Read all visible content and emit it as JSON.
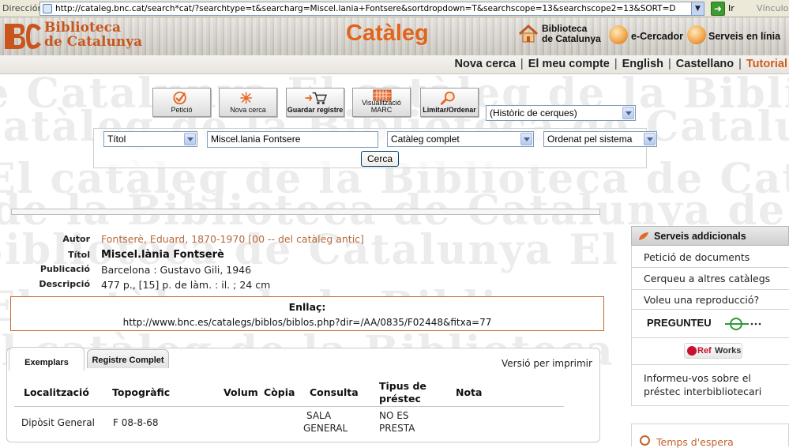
{
  "browser": {
    "address_label": "Dirección",
    "url": "http://cataleg.bnc.cat/search*cat/?searchtype=t&searcharg=Miscel.lania+Fontsere&sortdropdown=T&searchscope=13&searchscope2=13&SORT=D",
    "go_label": "Ir",
    "links_label": "Vínculos"
  },
  "watermark": {
    "line1": "de Catalunya El catàleg de la Biblioteca",
    "line2": "catàleg de la Biblioteca de Catalunya",
    "line3": "El catàleg de la Biblioteca de Catalunya",
    "line4": "de la Biblioteca de Catalunya de la Bibl",
    "line5": "Biblioteca de Catalunya El catàleg",
    "line6": "El catàleg de la Biblio",
    "line7": "El catàleg de la Biblioteca de Catalu"
  },
  "header": {
    "logo_line1": "Biblioteca",
    "logo_line2": "de Catalunya",
    "logo_mark": "BC",
    "app_title": "Catàleg",
    "links": [
      {
        "line1": "Biblioteca",
        "line2": "de Catalunya",
        "icon": "house-icon"
      },
      {
        "label": "e-Cercador",
        "icon": "magnifier-icon"
      },
      {
        "label": "Serveis en línia",
        "icon": "globe-icon"
      }
    ]
  },
  "topnav": {
    "items": [
      "Nova cerca",
      "El meu compte",
      "English",
      "Castellano",
      "Tutorial"
    ],
    "accent_color": "#d05a1b"
  },
  "toolbar": {
    "buttons": [
      {
        "label": "Petició",
        "icon": "checkmark-icon"
      },
      {
        "label": "Nova cerca",
        "icon": "sparkle-icon"
      },
      {
        "label": "Guardar registre",
        "icon": "cart-icon"
      },
      {
        "label1": "Visualització",
        "label2": "MARC",
        "icon": "grid-icon"
      },
      {
        "label": "Limitar/Ordenar",
        "icon": "magnifier-icon"
      }
    ],
    "history_select": "(Històric de cerques)"
  },
  "search": {
    "field_select": "Títol",
    "query": "Miscel.lania Fontsere",
    "scope_select": "Catàleg complet",
    "sort_select": "Ordenat pel sistema",
    "submit_label": "Cerca"
  },
  "record": {
    "fields": [
      {
        "key": "Autor",
        "value": "Fontserè, Eduard, 1870-1970 [00 -- del catàleg antic]"
      },
      {
        "key": "Títol",
        "value": "Miscel.lània Fontserè"
      },
      {
        "key": "Publicació",
        "value": "Barcelona : Gustavo Gili, 1946"
      },
      {
        "key": "Descripció",
        "value": "477 p., [15] p. de làm. : il. ; 24 cm"
      }
    ],
    "link_heading": "Enllaç:",
    "link_url": "http://www.bnc.es/catalegs/biblos/biblos.php?dir=/AA/0835/F02448&fitxa=77"
  },
  "holdings": {
    "tabs": [
      "Exemplars",
      "Registre Complet"
    ],
    "print_label": "Versió per imprimir",
    "columns": [
      "Localització",
      "Topogràfic",
      "Volum",
      "Còpia",
      "Consulta",
      "Tipus de préstec",
      "Nota"
    ],
    "col_tipus_line1": "Tipus de",
    "col_tipus_line2": "préstec",
    "rows": [
      {
        "localitzacio": "Dipòsit General",
        "topografic": "F 08-8-68",
        "consulta1": "SALA",
        "consulta2": "GENERAL",
        "tipus1": "NO ES",
        "tipus2": "PRESTA"
      }
    ]
  },
  "sidebar": {
    "heading": "Serveis addicionals",
    "items": [
      "Petició de documents",
      "Cerqueu a altres catàlegs",
      "Voleu una reproducció?"
    ],
    "pregunteu": "PREGUNTEU",
    "refworks_ref": "Ref",
    "refworks_works": "Works",
    "ill_line1": "Informeu-vos sobre el",
    "ill_line2": "préstec interbibliotecari",
    "waiting": "Temps d'espera"
  }
}
